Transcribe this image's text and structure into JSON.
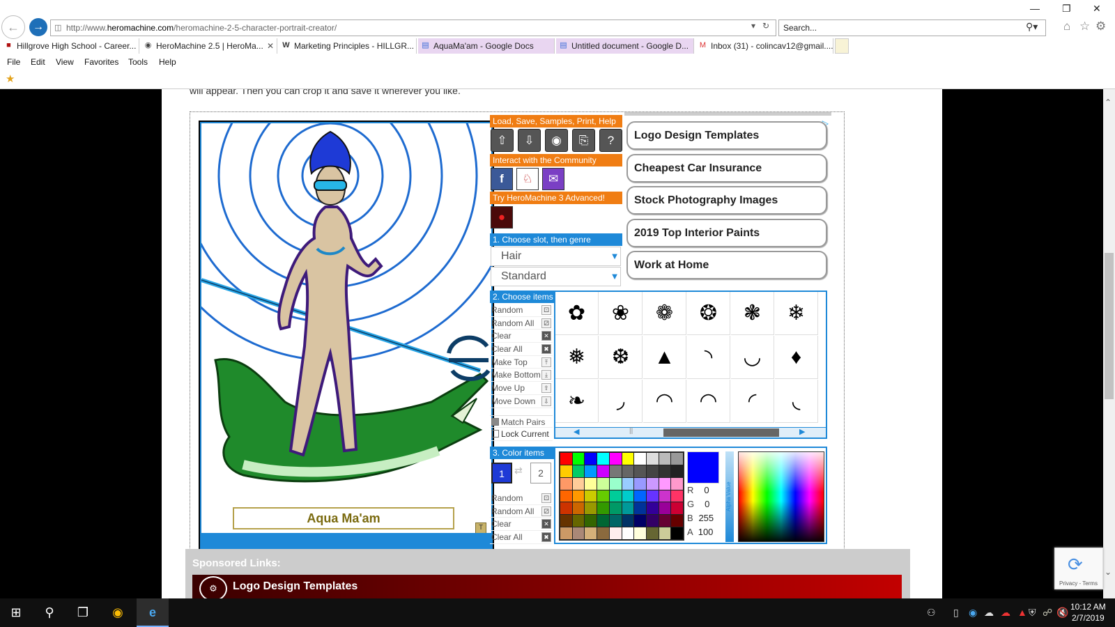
{
  "browser": {
    "url_prefix": "http://www.",
    "url_domain": "heromachine.com",
    "url_path": "/heromachine-2-5-character-portrait-creator/",
    "search_placeholder": "Search...",
    "tabs": [
      {
        "label": "Hillgrove High School - Career...",
        "icon": "school-icon",
        "active": false
      },
      {
        "label": "HeroMachine 2.5 | HeroMa...",
        "icon": "heromachine-icon",
        "active": true
      },
      {
        "label": "Marketing Principles - HILLGR...",
        "icon": "wordpress-icon",
        "active": false
      },
      {
        "label": "AquaMa'am - Google Docs",
        "icon": "docs-icon",
        "active": false
      },
      {
        "label": "Untitled document - Google D...",
        "icon": "docs-icon",
        "active": false
      },
      {
        "label": "Inbox (31) - colincav12@gmail....",
        "icon": "gmail-icon",
        "active": false
      }
    ],
    "menu": [
      "File",
      "Edit",
      "View",
      "Favorites",
      "Tools",
      "Help"
    ]
  },
  "page": {
    "intro_text": "will appear. Then you can crop it and save it wherever you like."
  },
  "heromachine": {
    "character_name": "Aqua Ma'am",
    "name_plate_button": "T",
    "header_load": "Load, Save, Samples, Print, Help",
    "tool_icons": [
      "upload-icon",
      "download-icon",
      "eye-icon",
      "print-icon",
      "help-icon"
    ],
    "header_community": "Interact with the Community",
    "social_icons": [
      "facebook-icon",
      "heromachine-logo-icon",
      "mail-icon"
    ],
    "header_advanced": "Try HeroMachine 3 Advanced!",
    "header_choose_slot": "1. Choose slot, then genre",
    "slot_value": "Hair",
    "genre_value": "Standard",
    "header_choose_items": "2. Choose items",
    "item_actions": [
      {
        "label": "Random",
        "icon": "random-icon"
      },
      {
        "label": "Random All",
        "icon": "random-all-icon"
      },
      {
        "label": "Clear",
        "icon": "clear-icon"
      },
      {
        "label": "Clear All",
        "icon": "clear-all-icon"
      },
      {
        "label": "Make Top",
        "icon": "make-top-icon"
      },
      {
        "label": "Make Bottom",
        "icon": "make-bottom-icon"
      },
      {
        "label": "Move Up",
        "icon": "move-up-icon"
      },
      {
        "label": "Move Down",
        "icon": "move-down-icon"
      }
    ],
    "match_pairs": "Match Pairs",
    "lock_current": "Lock Current",
    "header_color_items": "3. Color items",
    "color_slot_1": "1",
    "color_slot_2": "2",
    "color_actions": [
      {
        "label": "Random",
        "icon": "random-icon"
      },
      {
        "label": "Random All",
        "icon": "random-all-icon"
      },
      {
        "label": "Clear",
        "icon": "clear-icon"
      },
      {
        "label": "Clear All",
        "icon": "clear-all-icon"
      }
    ],
    "rgba": {
      "R": "0",
      "G": "0",
      "B": "255",
      "A": "100"
    },
    "current_color": "#0000ff",
    "alpha_label": "Alpha Value"
  },
  "ads": [
    "Logo Design Templates",
    "Cheapest Car Insurance",
    "Stock Photography Images",
    "2019 Top Interior Paints",
    "Work at Home"
  ],
  "sponsored": {
    "label": "Sponsored Links:",
    "first_link": "Logo Design Templates"
  },
  "recaptcha": {
    "text": "Privacy - Terms"
  },
  "taskbar": {
    "time": "10:12 AM",
    "date": "2/7/2019"
  }
}
